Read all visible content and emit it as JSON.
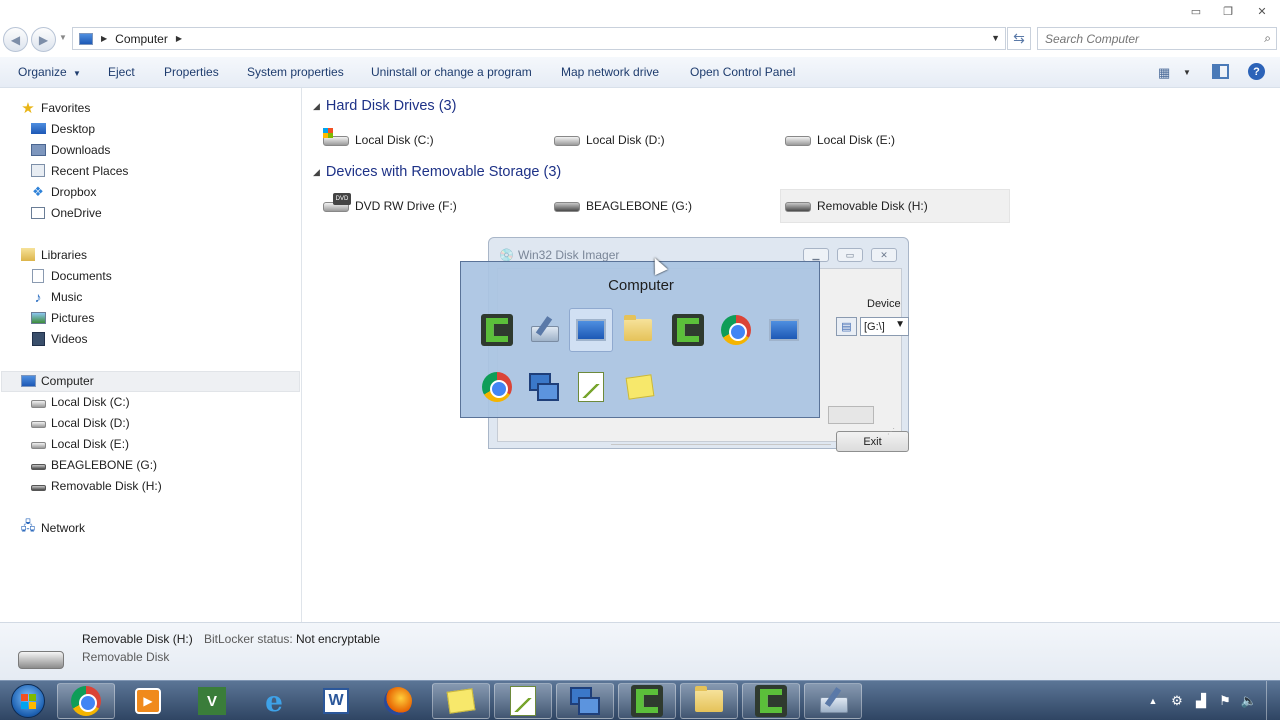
{
  "window": {
    "title": "",
    "minimize_glyph": "▭",
    "restore_glyph": "❐",
    "close_glyph": "✕"
  },
  "address": {
    "crumb": "Computer",
    "search_placeholder": "Search Computer"
  },
  "toolbar": {
    "items": [
      "Organize",
      "Eject",
      "Properties",
      "System properties",
      "Uninstall or change a program",
      "Map network drive",
      "Open Control Panel"
    ]
  },
  "nav": {
    "favorites": "Favorites",
    "favorites_items": [
      "Desktop",
      "Downloads",
      "Recent Places",
      "Dropbox",
      "OneDrive"
    ],
    "libraries": "Libraries",
    "libraries_items": [
      "Documents",
      "Music",
      "Pictures",
      "Videos"
    ],
    "computer": "Computer",
    "computer_items": [
      "Local Disk (C:)",
      "Local Disk (D:)",
      "Local Disk (E:)",
      "BEAGLEBONE (G:)",
      "Removable Disk (H:)"
    ],
    "network": "Network"
  },
  "content": {
    "hdd_group": "Hard Disk Drives (3)",
    "hdd": [
      "Local Disk (C:)",
      "Local Disk (D:)",
      "Local Disk (E:)"
    ],
    "removable_group": "Devices with Removable Storage (3)",
    "removable": [
      "DVD RW Drive (F:)",
      "BEAGLEBONE (G:)",
      "Removable Disk (H:)"
    ]
  },
  "imager": {
    "title": "Win32 Disk Imager",
    "device_label": "Device",
    "device_value": "[G:\\]",
    "exit_label": "Exit"
  },
  "switcher": {
    "title": "Computer",
    "apps": [
      "camtasia-icon",
      "tool-icon",
      "computer-icon",
      "folder-icon",
      "camtasia-icon",
      "chrome-icon",
      "desktop-icon",
      "chrome-icon",
      "network-icon",
      "notepad-plus-icon",
      "sticky-notes-icon"
    ]
  },
  "details": {
    "name": "Removable Disk (H:)",
    "bitlocker_label": "BitLocker status:",
    "bitlocker_value": "Not encryptable",
    "type": "Removable Disk"
  },
  "taskbar": {
    "apps": [
      "chrome-icon",
      "media-player-icon",
      "vs-icon",
      "ie-icon",
      "word-icon",
      "firefox-icon",
      "sticky-notes-icon",
      "notepad-plus-icon",
      "network-icon",
      "camtasia-icon",
      "explorer-icon",
      "camtasia-icon",
      "tool-icon"
    ]
  },
  "colors": {
    "accent": "#1e3287",
    "taskbar": "#2f4563",
    "switcher": "#aac4e2"
  }
}
